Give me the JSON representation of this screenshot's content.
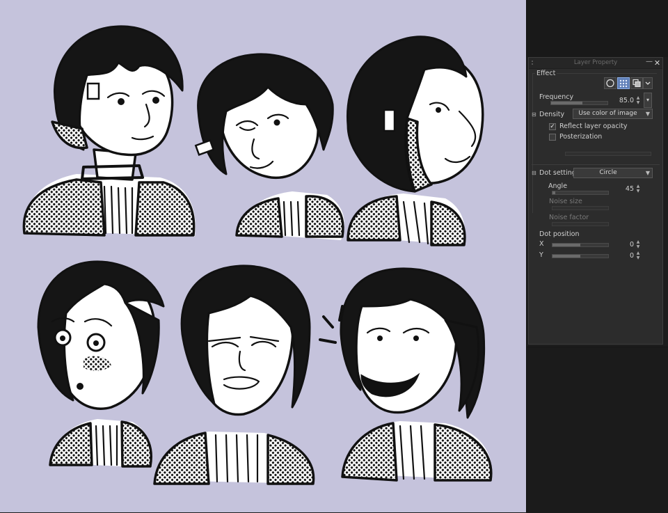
{
  "colors": {
    "canvas_background": "#c5c3dc",
    "dock_background": "#1d1d1d",
    "panel_background": "#2c2c2c",
    "accent_selected": "#5f7fb8"
  },
  "panel": {
    "title": "Layer Property",
    "minimize_icon": "minus-icon",
    "close_icon": "close-icon",
    "close_glyph": "✕",
    "minimize_glyph": "—"
  },
  "effect": {
    "label": "Effect",
    "buttons": [
      "border-effect-icon",
      "tone-effect-icon",
      "layer-color-icon",
      "more-icon"
    ]
  },
  "frequency": {
    "label": "Frequency",
    "value": "85.0",
    "fraction": 0.55
  },
  "density": {
    "label": "Density",
    "selected": "Use color of image"
  },
  "reflect_opacity": {
    "label": "Reflect layer opacity",
    "checked": true,
    "check_glyph": "✓"
  },
  "posterization": {
    "label": "Posterization",
    "checked": false
  },
  "dot_settings": {
    "label": "Dot settings",
    "selected": "Circle"
  },
  "angle": {
    "label": "Angle",
    "value": "45",
    "fraction": 0.05
  },
  "noise_size": {
    "label": "Noise size"
  },
  "noise_factor": {
    "label": "Noise factor"
  },
  "dot_position": {
    "label": "Dot position",
    "x": {
      "label": "X",
      "value": "0",
      "fraction": 0.5
    },
    "y": {
      "label": "Y",
      "value": "0",
      "fraction": 0.5
    }
  }
}
